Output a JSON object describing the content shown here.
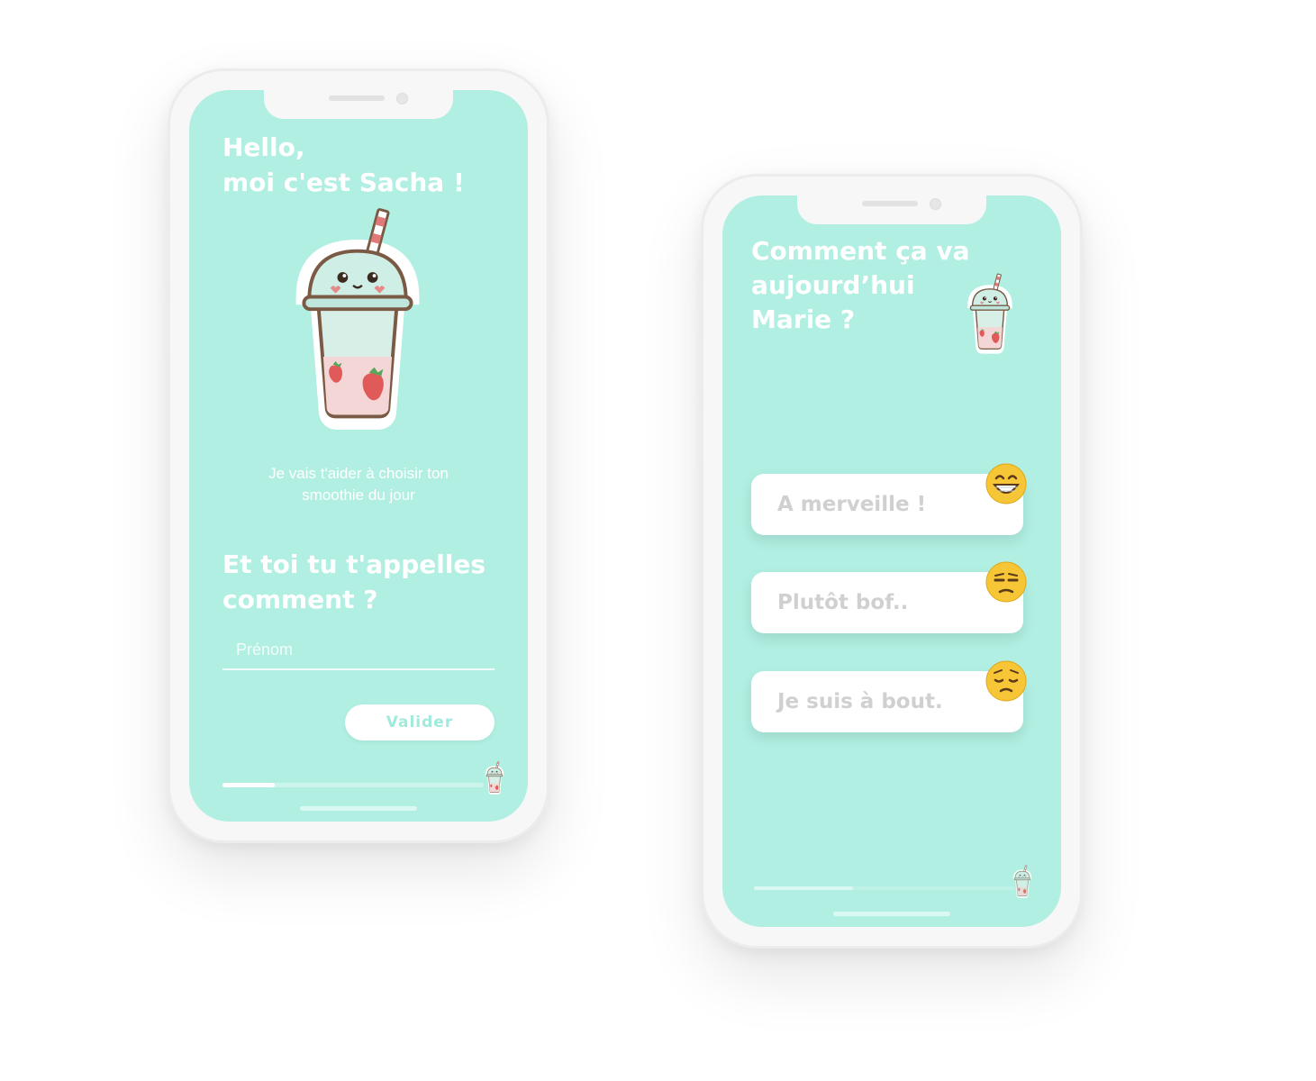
{
  "screen1": {
    "greeting": "Hello,\nmoi c'est Sacha !",
    "intro": "Je vais t'aider à choisir ton\nsmoothie du jour",
    "question": "Et toi tu t'appelles\ncomment ?",
    "name_placeholder": "Prénom",
    "name_value": "",
    "validate_label": "Valider",
    "progress": 0.2
  },
  "screen2": {
    "question": "Comment ça va\naujourd’hui\nMarie ?",
    "choices": [
      {
        "label": "A merveille !",
        "icon": "grinning-emoji-icon"
      },
      {
        "label": "Plutôt bof..",
        "icon": "unamused-emoji-icon"
      },
      {
        "label": "Je suis à bout.",
        "icon": "pensive-emoji-icon"
      }
    ],
    "progress": 0.38
  },
  "colors": {
    "screen_bg": "#b0efe2",
    "accent_text": "#9eeadb",
    "choice_text": "#d0d0d0"
  },
  "mascot": "strawberry-smoothie-cup-icon"
}
